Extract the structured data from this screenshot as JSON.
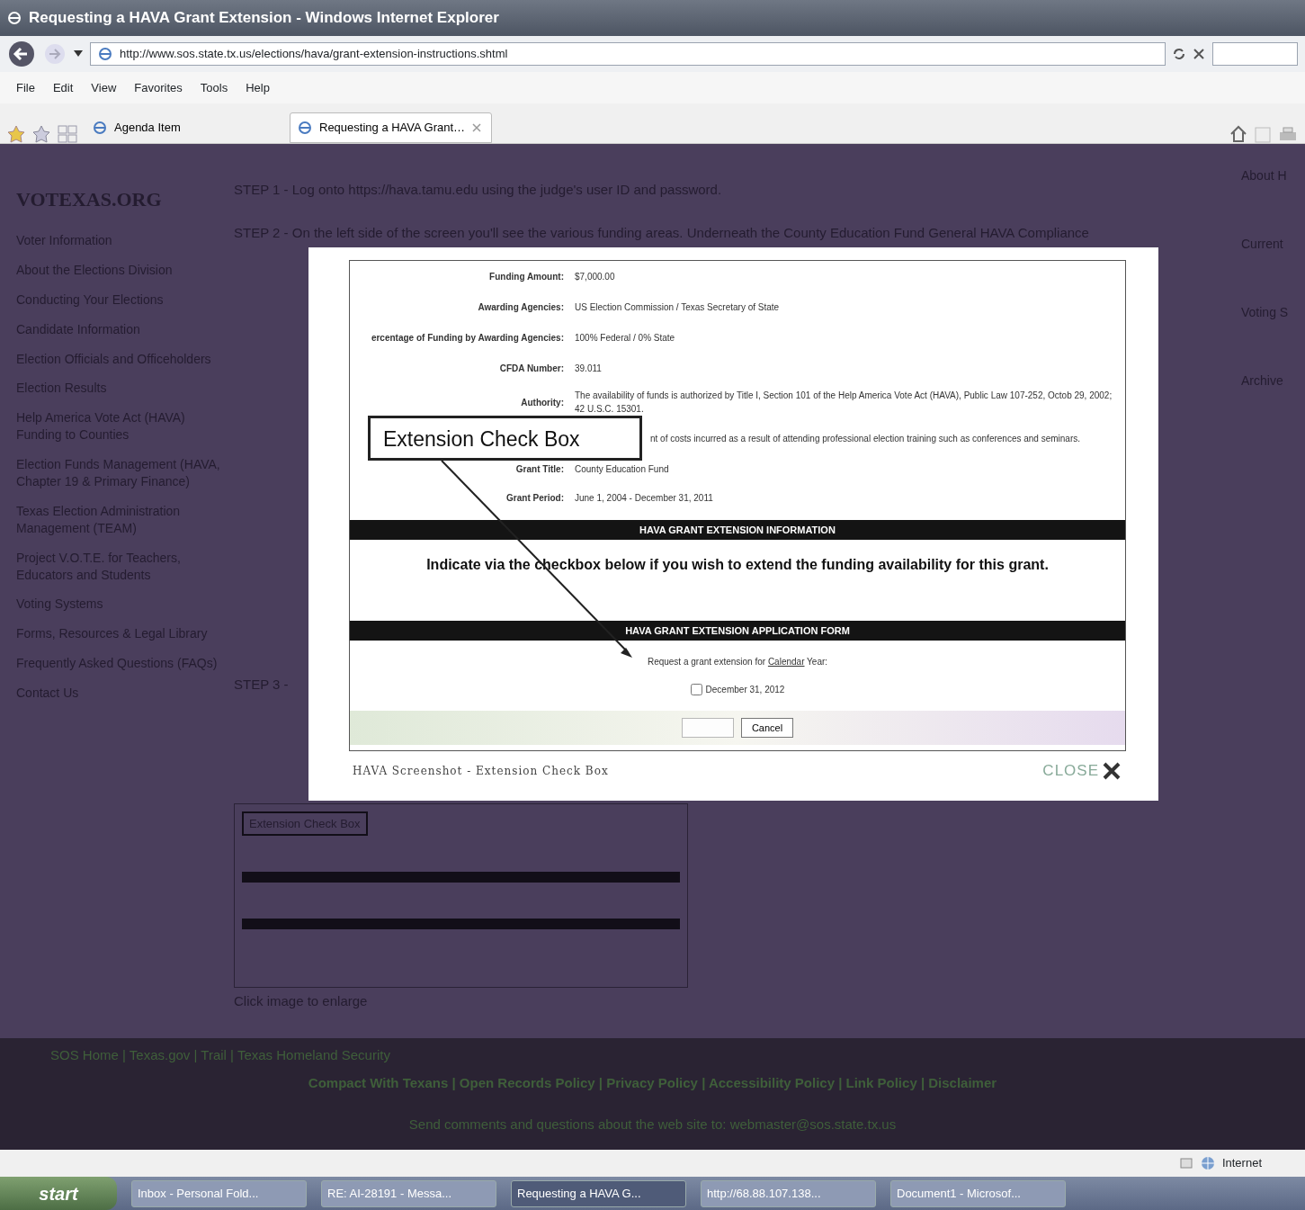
{
  "window": {
    "title": "Requesting a HAVA Grant Extension - Windows Internet Explorer"
  },
  "address": {
    "url": "http://www.sos.state.tx.us/elections/hava/grant-extension-instructions.shtml"
  },
  "menu": [
    "File",
    "Edit",
    "View",
    "Favorites",
    "Tools",
    "Help"
  ],
  "tabs": [
    {
      "label": "Agenda Item",
      "selected": false
    },
    {
      "label": "Requesting a HAVA Grant…",
      "selected": true
    }
  ],
  "page": {
    "logo": "VOTEXAS.ORG",
    "nav_items": [
      "Voter Information",
      "About the Elections Division",
      "Conducting Your Elections",
      "Candidate Information",
      "Election Officials and Officeholders",
      "Election Results",
      "Help America Vote Act (HAVA) Funding to Counties",
      "Election Funds Management (HAVA, Chapter 19 & Primary Finance)",
      "Texas Election Administration Management (TEAM)",
      "Project V.O.T.E. for Teachers, Educators and Students",
      "Voting Systems",
      "Forms, Resources & Legal Library",
      "Frequently Asked Questions (FAQs)",
      "Contact Us"
    ],
    "steps": [
      "STEP 1 - Log onto https://hava.tamu.edu using the judge's user ID and password.",
      "STEP 2 - On the left side of the screen you'll see the various funding areas. Underneath the County Education Fund General HAVA Compliance",
      "STEP 3 -"
    ],
    "thumbnail_callout": "Extension Check Box",
    "thumbnail_caption": "Click image to enlarge",
    "right_items": [
      "About H",
      "Current",
      "Voting S",
      "Archive"
    ],
    "footer": {
      "top_links": "SOS Home | Texas.gov | Trail | Texas Homeland Security",
      "policy_links": "Compact With Texans | Open Records Policy | Privacy Policy | Accessibility Policy | Link Policy | Disclaimer",
      "contact": "Send comments and questions about the web site to: webmaster@sos.state.tx.us"
    }
  },
  "modal": {
    "rows": [
      {
        "label": "Funding Amount:",
        "value": "$7,000.00"
      },
      {
        "label": "Awarding Agencies:",
        "value": "US Election Commission / Texas Secretary of State"
      },
      {
        "label": "ercentage of Funding by Awarding Agencies:",
        "value": "100% Federal / 0% State"
      },
      {
        "label": "CFDA Number:",
        "value": "39.011"
      },
      {
        "label": "Authority:",
        "value": "The availability of funds is authorized by Title I, Section 101 of the Help America Vote Act (HAVA), Public Law 107-252, Octob 29, 2002; 42 U.S.C. 15301."
      },
      {
        "label": "",
        "value": "nt of costs incurred as a result of attending professional election training such as conferences and seminars."
      },
      {
        "label": "Grant Title:",
        "value": "County Education Fund"
      },
      {
        "label": "Grant Period:",
        "value": "June 1, 2004 - December 31, 2011"
      }
    ],
    "info_header": "HAVA GRANT EXTENSION INFORMATION",
    "info_text": "Indicate via the checkbox below if you wish to extend the funding availability for this grant.",
    "form_header": "HAVA GRANT EXTENSION APPLICATION FORM",
    "request": {
      "text_before": "Request a grant extension for",
      "link": "Calendar",
      "text_after": "Year:"
    },
    "checkbox": {
      "label": "December 31, 2012",
      "checked": false
    },
    "buttons": [
      {
        "kind": "submit",
        "disabled": true
      },
      {
        "kind": "cancel",
        "label": "Cancel",
        "disabled": false
      }
    ],
    "callout": "Extension Check Box",
    "caption": "HAVA Screenshot - Extension Check Box",
    "close_label": "CLOSE"
  },
  "status_bar": {
    "zone": "Internet"
  },
  "taskbar": {
    "start": "start",
    "items": [
      {
        "label": "Inbox - Personal Fold...",
        "selected": false
      },
      {
        "label": "RE: AI-28191 - Messa...",
        "selected": false
      },
      {
        "label": "Requesting a HAVA G...",
        "selected": true
      },
      {
        "label": "http://68.88.107.138...",
        "selected": false
      },
      {
        "label": "Document1 - Microsof...",
        "selected": false
      }
    ]
  }
}
